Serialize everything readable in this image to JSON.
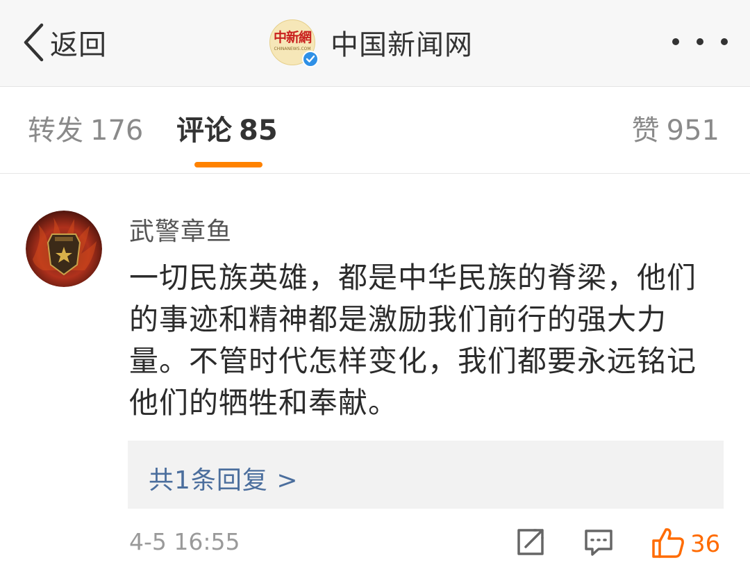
{
  "nav": {
    "back_label": "返回",
    "account_name": "中国新闻网",
    "logo_text": "中新網",
    "logo_subtext": "CHINANEWS.COM"
  },
  "tabs": {
    "repost": {
      "label": "转发",
      "count": "176"
    },
    "comment": {
      "label": "评论",
      "count": "85"
    },
    "like": {
      "label": "赞",
      "count": "951"
    },
    "active": "comment"
  },
  "comment": {
    "username": "武警章鱼",
    "text": "一切民族英雄，都是中华民族的脊梁，他们的事迹和精神都是激励我们前行的强大力量。不管时代怎样变化，我们都要永远铭记他们的牺牲和奉献。",
    "reply_link": "共1条回复 >",
    "timestamp": "4-5 16:55",
    "like_count": "36"
  },
  "colors": {
    "accent": "#ff8200",
    "link": "#4b6e9d",
    "like": "#ff6b00",
    "verified": "#2f90e6"
  },
  "icons": {
    "back": "chevron-left-icon",
    "more": "more-dots-icon",
    "verified": "verified-badge-icon",
    "share": "share-icon",
    "reply": "comment-icon",
    "like": "thumbs-up-icon"
  }
}
